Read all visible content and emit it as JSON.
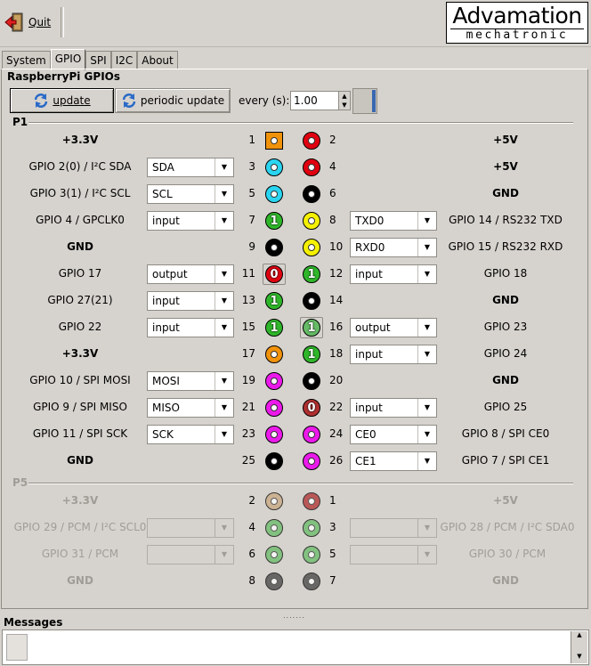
{
  "toolbar": {
    "quit_label": "Quit"
  },
  "logo": {
    "line1": "Advamation",
    "line2": "mechatronic"
  },
  "tabs": [
    {
      "label": "System",
      "active": false
    },
    {
      "label": "GPIO",
      "active": true
    },
    {
      "label": "SPI",
      "active": false
    },
    {
      "label": "I2C",
      "active": false
    },
    {
      "label": "About",
      "active": false
    }
  ],
  "gpio": {
    "group_title": "RaspberryPi GPIOs",
    "update_label": "update",
    "periodic_label": "periodic update",
    "every_label": "every (s):",
    "every_value": "1.00"
  },
  "sections": {
    "p1": "P1",
    "p5": "P5"
  },
  "colors": {
    "orange": "#f0920a",
    "red": "#e00010",
    "black": "#000000",
    "cyan": "#2ad4f0",
    "yellow": "#f4f000",
    "green": "#2fb62a",
    "magenta": "#ea1aea",
    "brown": "#c8a880",
    "darkred": "#b03030",
    "lightgreen": "#66bb66",
    "gray": "#444444"
  },
  "p1_rows": [
    {
      "l_label": "+3.3V",
      "l_bold": true,
      "l_num": "1",
      "l_pin": "orange",
      "l_shape": "square",
      "l_digit": "",
      "r_num": "2",
      "r_pin": "red",
      "r_digit": "",
      "r_label": "+5V",
      "r_bold": true
    },
    {
      "l_label": "GPIO 2(0) / I²C SDA",
      "l_select": "SDA",
      "l_num": "3",
      "l_pin": "cyan",
      "l_digit": "",
      "r_num": "4",
      "r_pin": "red",
      "r_digit": "",
      "r_label": "+5V",
      "r_bold": true
    },
    {
      "l_label": "GPIO 3(1) / I²C SCL",
      "l_select": "SCL",
      "l_num": "5",
      "l_pin": "cyan",
      "l_digit": "",
      "r_num": "6",
      "r_pin": "black",
      "r_digit": "",
      "r_label": "GND",
      "r_bold": true
    },
    {
      "l_label": "GPIO 4 / GPCLK0",
      "l_select": "input",
      "l_num": "7",
      "l_pin": "green",
      "l_digit": "1",
      "r_num": "8",
      "r_pin": "yellow",
      "r_digit": "",
      "r_select": "TXD0",
      "r_label": "GPIO 14 / RS232 TXD"
    },
    {
      "l_label": "GND",
      "l_bold": true,
      "l_num": "9",
      "l_pin": "black",
      "l_digit": "",
      "r_num": "10",
      "r_pin": "yellow",
      "r_digit": "",
      "r_select": "RXD0",
      "r_label": "GPIO 15 / RS232 RXD"
    },
    {
      "l_label": "GPIO 17",
      "l_select": "output",
      "l_num": "11",
      "l_pin": "red",
      "l_shape": "button",
      "l_digit": "0",
      "r_num": "12",
      "r_pin": "green",
      "r_digit": "1",
      "r_select": "input",
      "r_label": "GPIO 18"
    },
    {
      "l_label": "GPIO 27(21)",
      "l_select": "input",
      "l_num": "13",
      "l_pin": "green",
      "l_digit": "1",
      "r_num": "14",
      "r_pin": "black",
      "r_digit": "",
      "r_label": "GND",
      "r_bold": true
    },
    {
      "l_label": "GPIO 22",
      "l_select": "input",
      "l_num": "15",
      "l_pin": "green",
      "l_digit": "1",
      "r_num": "16",
      "r_pin": "lightgreen",
      "r_shape": "button",
      "r_digit": "1",
      "r_select": "output",
      "r_label": "GPIO 23"
    },
    {
      "l_label": "+3.3V",
      "l_bold": true,
      "l_num": "17",
      "l_pin": "orange",
      "l_digit": "",
      "r_num": "18",
      "r_pin": "green",
      "r_digit": "1",
      "r_select": "input",
      "r_label": "GPIO 24"
    },
    {
      "l_label": "GPIO 10 / SPI MOSI",
      "l_select": "MOSI",
      "l_num": "19",
      "l_pin": "magenta",
      "l_digit": "",
      "r_num": "20",
      "r_pin": "black",
      "r_digit": "",
      "r_label": "GND",
      "r_bold": true
    },
    {
      "l_label": "GPIO 9 / SPI MISO",
      "l_select": "MISO",
      "l_num": "21",
      "l_pin": "magenta",
      "l_digit": "",
      "r_num": "22",
      "r_pin": "darkred",
      "r_digit": "0",
      "r_select": "input",
      "r_label": "GPIO 25"
    },
    {
      "l_label": "GPIO 11 / SPI SCK",
      "l_select": "SCK",
      "l_num": "23",
      "l_pin": "magenta",
      "l_digit": "",
      "r_num": "24",
      "r_pin": "magenta",
      "r_digit": "",
      "r_select": "CE0",
      "r_label": "GPIO 8 / SPI CE0"
    },
    {
      "l_label": "GND",
      "l_bold": true,
      "l_num": "25",
      "l_pin": "black",
      "l_digit": "",
      "r_num": "26",
      "r_pin": "magenta",
      "r_digit": "",
      "r_select": "CE1",
      "r_label": "GPIO 7 / SPI CE1"
    }
  ],
  "p5_rows": [
    {
      "l_label": "+3.3V",
      "l_bold": true,
      "l_num": "2",
      "l_pin": "brown",
      "l_digit": "",
      "r_num": "1",
      "r_pin": "darkred",
      "r_digit": "",
      "r_label": "+5V",
      "r_bold": true
    },
    {
      "l_label": "GPIO 29 / PCM / I²C SCL0",
      "l_select": "",
      "l_num": "4",
      "l_pin": "lightgreen",
      "l_digit": "",
      "r_num": "3",
      "r_pin": "lightgreen",
      "r_digit": "",
      "r_select": "",
      "r_label": "GPIO 28 / PCM / I²C SDA0"
    },
    {
      "l_label": "GPIO 31 / PCM",
      "l_select": "",
      "l_num": "6",
      "l_pin": "lightgreen",
      "l_digit": "",
      "r_num": "5",
      "r_pin": "lightgreen",
      "r_digit": "",
      "r_select": "",
      "r_label": "GPIO 30 / PCM"
    },
    {
      "l_label": "GND",
      "l_bold": true,
      "l_num": "8",
      "l_pin": "gray",
      "l_digit": "",
      "r_num": "7",
      "r_pin": "gray",
      "r_digit": "",
      "r_label": "GND",
      "r_bold": true
    }
  ],
  "messages": {
    "title": "Messages"
  }
}
